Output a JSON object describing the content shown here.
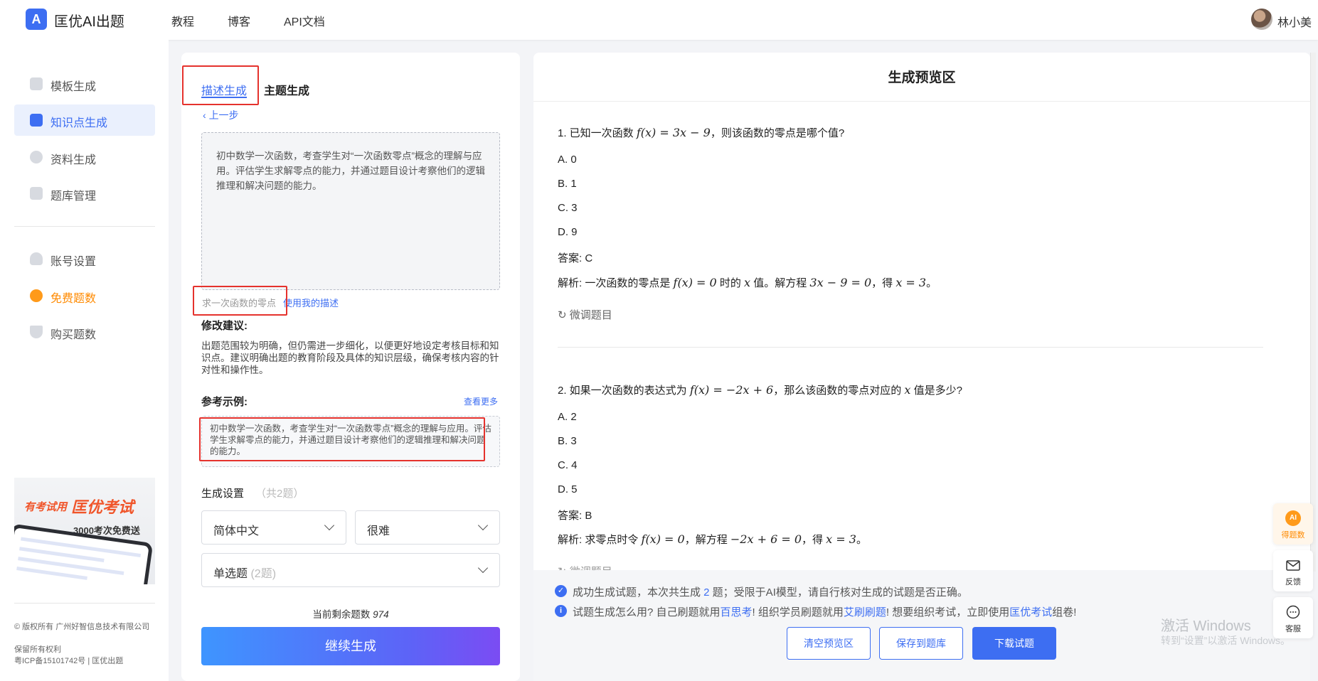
{
  "header": {
    "logo_mark": "A",
    "app_name": "匡优AI出题",
    "nav": [
      "教程",
      "博客",
      "API文档"
    ],
    "user_name": "林小美"
  },
  "sidebar": {
    "items": [
      {
        "label": "模板生成",
        "active": false
      },
      {
        "label": "知识点生成",
        "active": true
      },
      {
        "label": "资料生成",
        "active": false
      },
      {
        "label": "题库管理",
        "active": false
      },
      {
        "label": "账号设置",
        "active": false
      },
      {
        "label": "免费题数",
        "active": false
      },
      {
        "label": "购买题数",
        "active": false
      }
    ],
    "promo": {
      "line1": "有考试用",
      "line2": "匡优考试",
      "line3": "3000考次免费送"
    },
    "copyright": [
      "© 版权所有 广州好智信息技术有限公司",
      "保留所有权利",
      "粤ICP备15101742号 | 匡优出题"
    ]
  },
  "left_panel": {
    "tabs": [
      "描述生成",
      "主题生成"
    ],
    "back": "上一步",
    "description": "初中数学一次函数，考查学生对“一次函数零点”概念的理解与应用。评估学生求解零点的能力，并通过题目设计考察他们的逻辑推理和解决问题的能力。",
    "hint_placeholder": "求一次函数的零点",
    "use_my_desc": "使用我的描述",
    "suggestion_title": "修改建议:",
    "suggestion_text": "出题范围较为明确，但仍需进一步细化，以便更好地设定考核目标和知识点。建议明确出题的教育阶段及具体的知识层级，确保考核内容的针对性和操作性。",
    "reference_title": "参考示例:",
    "reference_more": "查看更多",
    "reference_text": "初中数学一次函数，考查学生对“一次函数零点”概念的理解与应用。评估学生求解零点的能力，并通过题目设计考察他们的逻辑推理和解决问题的能力。",
    "gen_settings_title": "生成设置",
    "gen_settings_count": "（共2题）",
    "language": "简体中文",
    "difficulty": "很难",
    "question_type": "单选题",
    "question_type_count": "(2题)",
    "remaining_label": "当前剩余题数",
    "remaining_value": "974",
    "continue_button": "继续生成"
  },
  "preview": {
    "title": "生成预览区",
    "q1": {
      "stem_a": "1. 已知一次函数 ",
      "stem_math": "f(x) = 3x − 9",
      "stem_b": "，则该函数的零点是哪个值?",
      "options": [
        "A. 0",
        "B. 1",
        "C. 3",
        "D. 9"
      ],
      "answer": "答案: C",
      "exp_a": "解析: 一次函数的零点是 ",
      "exp_m1": "f(x) = 0",
      "exp_b": " 时的 ",
      "exp_m2": "x",
      "exp_c": " 值。解方程 ",
      "exp_m3": "3x − 9 = 0",
      "exp_d": "，得 ",
      "exp_m4": "x = 3",
      "exp_e": "。"
    },
    "fine_tune": "微调题目",
    "q2": {
      "stem_a": "2. 如果一次函数的表达式为 ",
      "stem_math": "f(x) = −2x + 6",
      "stem_b": "，那么该函数的零点对应的 ",
      "stem_math2": "x",
      "stem_c": " 值是多少?",
      "options": [
        "A. 2",
        "B. 3",
        "C. 4",
        "D. 5"
      ],
      "answer": "答案: B",
      "exp_a": "解析: 求零点时令 ",
      "exp_m1": "f(x) = 0",
      "exp_b": "，解方程 ",
      "exp_m2": "−2x + 6 = 0",
      "exp_c": "，得 ",
      "exp_m3": "x = 3",
      "exp_d": "。"
    }
  },
  "status": {
    "line1_a": "成功生成试题，本次共生成 ",
    "line1_count": "2",
    "line1_b": " 题；受限于AI模型，请自行核对生成的试题是否正确。",
    "line2_a": "试题生成怎么用? 自己刷题就用",
    "line2_link1": "百思考",
    "line2_b": "! 组织学员刷题就用",
    "line2_link2": "艾刷刷题",
    "line2_c": "!  想要组织考试，立即使用",
    "line2_link3": "匡优考试",
    "line2_d": "组卷!",
    "buttons": [
      "清空预览区",
      "保存到题库",
      "下载试题"
    ]
  },
  "float_bar": [
    "得题数",
    "反馈",
    "客服"
  ],
  "watermark": {
    "line1": "激活 Windows",
    "line2": "转到“设置”以激活 Windows。"
  },
  "colors": {
    "accent": "#3d6ef2",
    "highlight": "#e5322d",
    "free": "#ff8a00"
  }
}
